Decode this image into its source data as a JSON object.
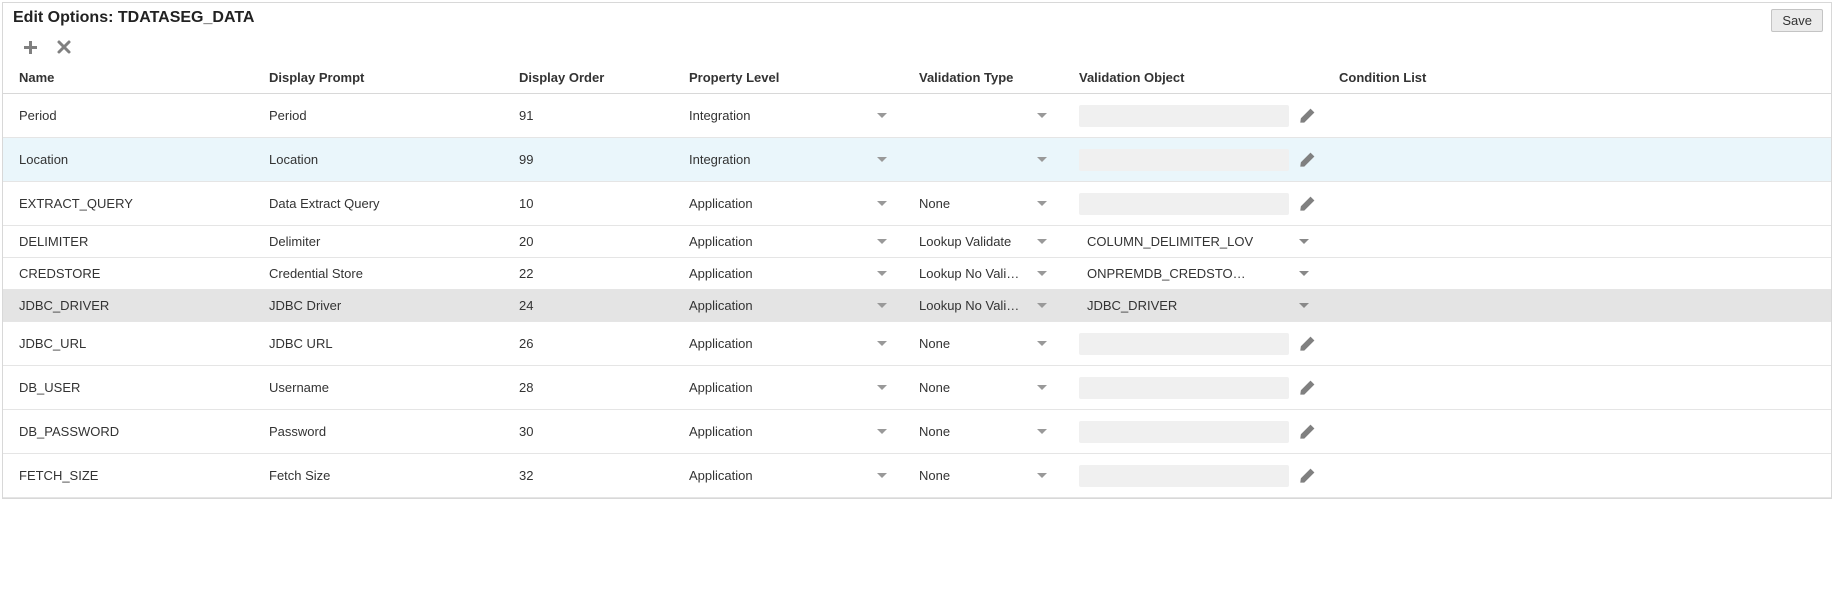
{
  "header": {
    "title": "Edit Options: TDATASEG_DATA",
    "save_label": "Save"
  },
  "columns": {
    "name": "Name",
    "prompt": "Display Prompt",
    "order": "Display Order",
    "plevel": "Property Level",
    "vtype": "Validation Type",
    "vobj": "Validation Object",
    "cond": "Condition List"
  },
  "rows": [
    {
      "name": "Period",
      "prompt": "Period",
      "order": "91",
      "plevel": "Integration",
      "vtype": "",
      "vobj": "",
      "vobj_dd": false,
      "pencil": true,
      "highlight": false,
      "small": false,
      "selected": false
    },
    {
      "name": "Location",
      "prompt": "Location",
      "order": "99",
      "plevel": "Integration",
      "vtype": "",
      "vobj": "",
      "vobj_dd": false,
      "pencil": true,
      "highlight": true,
      "small": false,
      "selected": false
    },
    {
      "name": "EXTRACT_QUERY",
      "prompt": "Data Extract Query",
      "order": "10",
      "plevel": "Application",
      "vtype": "None",
      "vobj": "",
      "vobj_dd": false,
      "pencil": true,
      "highlight": false,
      "small": false,
      "selected": false
    },
    {
      "name": "DELIMITER",
      "prompt": "Delimiter",
      "order": "20",
      "plevel": "Application",
      "vtype": "Lookup Validate",
      "vobj": "COLUMN_DELIMITER_LOV",
      "vobj_dd": true,
      "pencil": false,
      "highlight": false,
      "small": true,
      "selected": false
    },
    {
      "name": "CREDSTORE",
      "prompt": "Credential Store",
      "order": "22",
      "plevel": "Application",
      "vtype": "Lookup No Vali…",
      "vobj": "ONPREMDB_CREDSTO…",
      "vobj_dd": true,
      "pencil": false,
      "highlight": false,
      "small": true,
      "selected": false
    },
    {
      "name": "JDBC_DRIVER",
      "prompt": "JDBC Driver",
      "order": "24",
      "plevel": "Application",
      "vtype": "Lookup No Vali…",
      "vobj": "JDBC_DRIVER",
      "vobj_dd": true,
      "pencil": false,
      "highlight": false,
      "small": true,
      "selected": true
    },
    {
      "name": "JDBC_URL",
      "prompt": "JDBC URL",
      "order": "26",
      "plevel": "Application",
      "vtype": "None",
      "vobj": "",
      "vobj_dd": false,
      "pencil": true,
      "highlight": false,
      "small": false,
      "selected": false
    },
    {
      "name": "DB_USER",
      "prompt": "Username",
      "order": "28",
      "plevel": "Application",
      "vtype": "None",
      "vobj": "",
      "vobj_dd": false,
      "pencil": true,
      "highlight": false,
      "small": false,
      "selected": false
    },
    {
      "name": "DB_PASSWORD",
      "prompt": "Password",
      "order": "30",
      "plevel": "Application",
      "vtype": "None",
      "vobj": "",
      "vobj_dd": false,
      "pencil": true,
      "highlight": false,
      "small": false,
      "selected": false
    },
    {
      "name": "FETCH_SIZE",
      "prompt": "Fetch Size",
      "order": "32",
      "plevel": "Application",
      "vtype": "None",
      "vobj": "",
      "vobj_dd": false,
      "pencil": true,
      "highlight": false,
      "small": false,
      "selected": false
    }
  ]
}
